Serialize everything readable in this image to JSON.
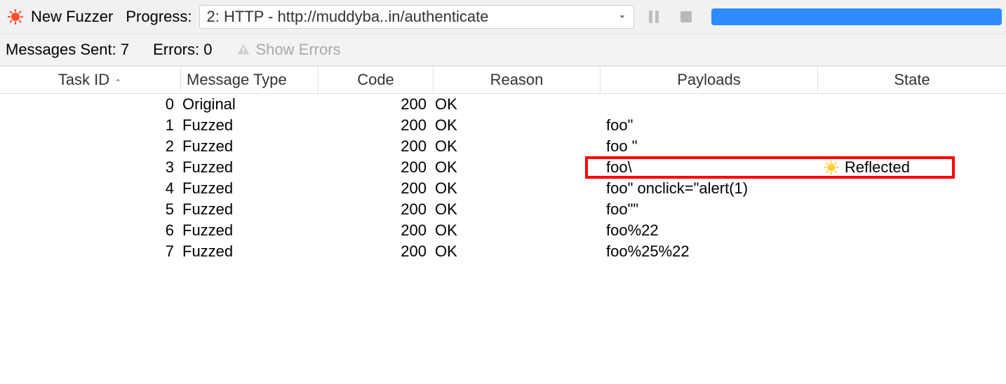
{
  "toolbar": {
    "new_fuzzer_label": "New Fuzzer",
    "progress_label": "Progress:",
    "select_value": "2: HTTP - http://muddyba..in/authenticate"
  },
  "status": {
    "messages_sent_label": "Messages Sent:",
    "messages_sent_value": "7",
    "errors_label": "Errors:",
    "errors_value": "0",
    "show_errors_label": "Show Errors"
  },
  "columns": {
    "task_id": "Task ID",
    "message_type": "Message Type",
    "code": "Code",
    "reason": "Reason",
    "payloads": "Payloads",
    "state": "State"
  },
  "rows": [
    {
      "id": "0",
      "type": "Original",
      "code": "200",
      "reason": "OK",
      "payload": "",
      "state": ""
    },
    {
      "id": "1",
      "type": "Fuzzed",
      "code": "200",
      "reason": "OK",
      "payload": "foo\"",
      "state": ""
    },
    {
      "id": "2",
      "type": "Fuzzed",
      "code": "200",
      "reason": "OK",
      "payload": "foo \"",
      "state": ""
    },
    {
      "id": "3",
      "type": "Fuzzed",
      "code": "200",
      "reason": "OK",
      "payload": "foo\\",
      "state": "Reflected"
    },
    {
      "id": "4",
      "type": "Fuzzed",
      "code": "200",
      "reason": "OK",
      "payload": "foo\" onclick=\"alert(1)",
      "state": ""
    },
    {
      "id": "5",
      "type": "Fuzzed",
      "code": "200",
      "reason": "OK",
      "payload": "foo\"\"",
      "state": ""
    },
    {
      "id": "6",
      "type": "Fuzzed",
      "code": "200",
      "reason": "OK",
      "payload": "foo%22",
      "state": ""
    },
    {
      "id": "7",
      "type": "Fuzzed",
      "code": "200",
      "reason": "OK",
      "payload": "foo%25%22",
      "state": ""
    }
  ],
  "highlight_row_index": 3
}
